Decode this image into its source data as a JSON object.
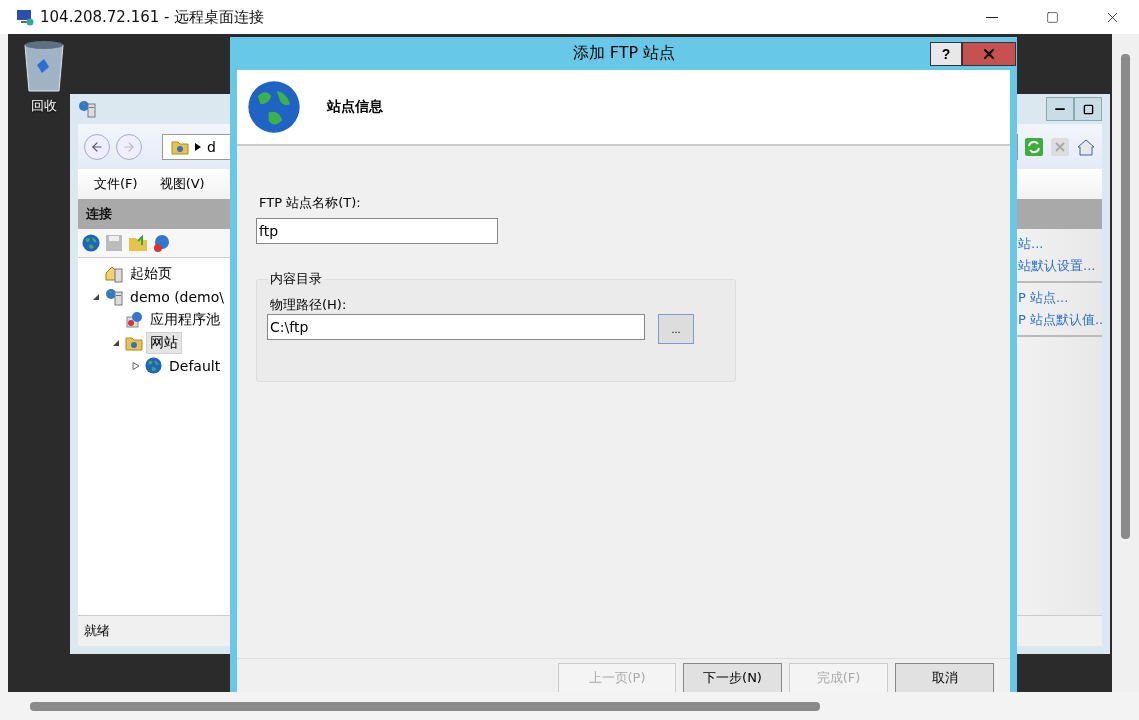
{
  "window": {
    "title": "104.208.72.161 - 远程桌面连接"
  },
  "desktop": {
    "icons": [
      {
        "label": "回收"
      }
    ]
  },
  "iis_window": {
    "address": "d",
    "menu": [
      {
        "label": "文件(F)"
      },
      {
        "label": "视图(V)"
      }
    ],
    "connections": {
      "title": "连接",
      "tree": [
        {
          "label": "起始页",
          "kind": "home",
          "selected": false
        },
        {
          "label": "demo (demo\\",
          "kind": "server",
          "expanded": true,
          "selected": false,
          "children": [
            {
              "label": "应用程序池",
              "kind": "pool",
              "selected": false
            },
            {
              "label": "网站",
              "kind": "folder",
              "expanded": true,
              "selected": true,
              "children": [
                {
                  "label": "Default",
                  "kind": "globe",
                  "expanded": false,
                  "selected": false
                }
              ]
            }
          ]
        }
      ]
    },
    "actions": [
      {
        "items": [
          {
            "label": "站..."
          },
          {
            "label": "站默认设置..."
          }
        ]
      },
      {
        "items": [
          {
            "label": "P 站点..."
          },
          {
            "label": "P 站点默认值.."
          }
        ]
      }
    ],
    "status": "就绪"
  },
  "dialog": {
    "title": "添加 FTP 站点",
    "help": "?",
    "heading": "站点信息",
    "site_name": {
      "label": "FTP 站点名称(T):",
      "value": "ftp"
    },
    "content_group": {
      "title": "内容目录",
      "path_label": "物理路径(H):",
      "path_value": "C:\\ftp",
      "browse": "..."
    },
    "buttons": [
      {
        "label": "上一页(P)",
        "disabled": true
      },
      {
        "label": "下一步(N)",
        "disabled": false
      },
      {
        "label": "完成(F)",
        "disabled": true
      },
      {
        "label": "取消",
        "disabled": false
      }
    ]
  }
}
